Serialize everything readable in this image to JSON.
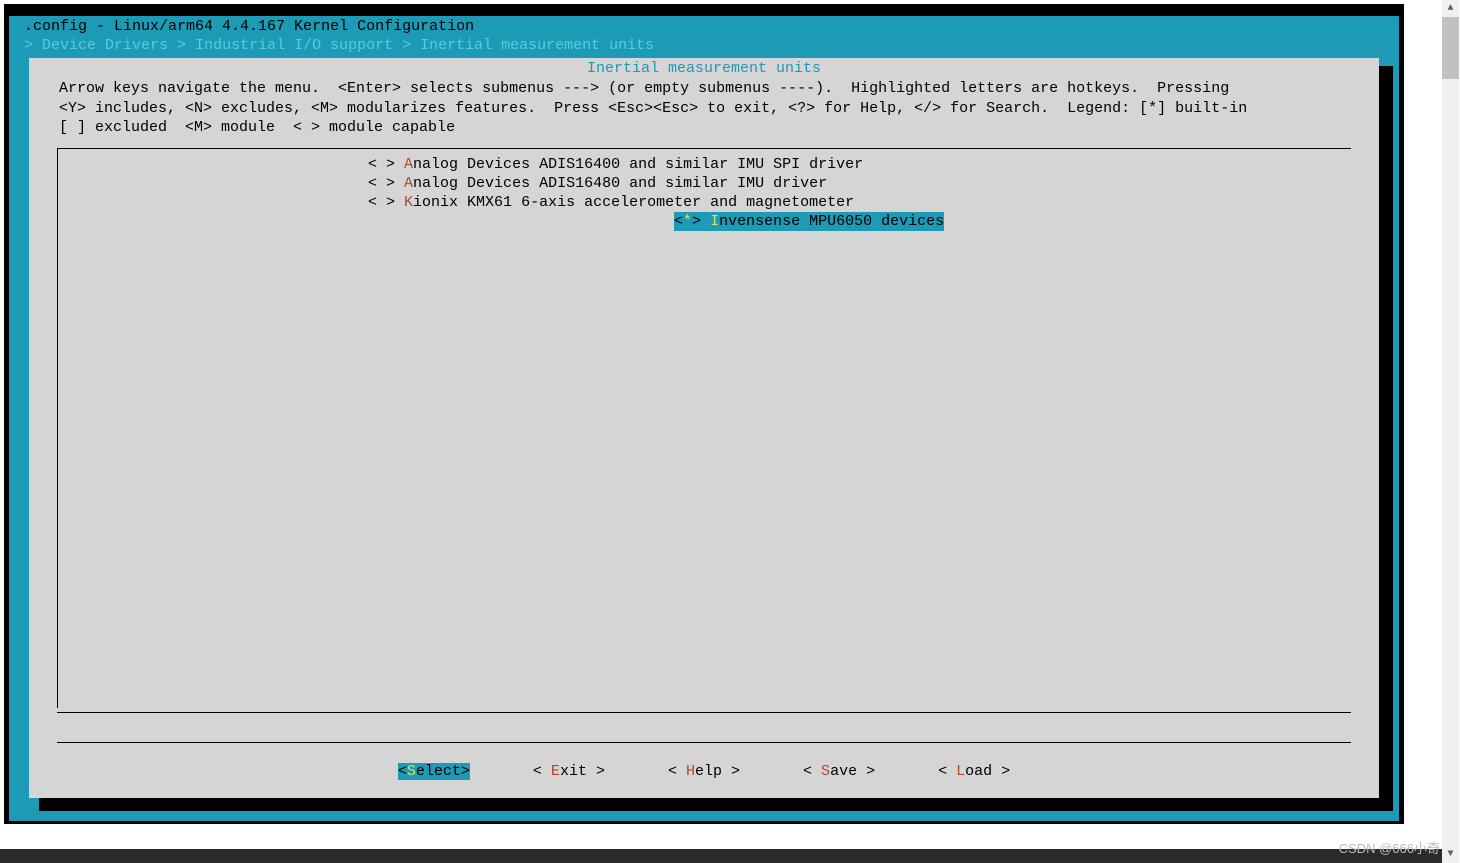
{
  "title_bar": ".config - Linux/arm64 4.4.167 Kernel Configuration",
  "breadcrumb": {
    "arrow": " > ",
    "items": [
      "Device Drivers",
      "Industrial I/O support",
      "Inertial measurement units"
    ],
    "tail_rule": " ───────────────────────────────────────────────────────────────────────────"
  },
  "panel": {
    "title": "Inertial measurement units",
    "help_text": "Arrow keys navigate the menu.  <Enter> selects submenus ---> (or empty submenus ----).  Highlighted letters are hotkeys.  Pressing\n<Y> includes, <N> excludes, <M> modularizes features.  Press <Esc><Esc> to exit, <?> for Help, </> for Search.  Legend: [*] built-in\n[ ] excluded  <M> module  < > module capable"
  },
  "menu_items": [
    {
      "bracket": "< >",
      "hotkey": "A",
      "rest": "nalog Devices ADIS16400 and similar IMU SPI driver",
      "selected": false
    },
    {
      "bracket": "< >",
      "hotkey": "A",
      "rest": "nalog Devices ADIS16480 and similar IMU driver",
      "selected": false
    },
    {
      "bracket": "< >",
      "hotkey": "K",
      "rest": "ionix KMX61 6-axis accelerometer and magnetometer",
      "selected": false
    },
    {
      "bracket_l": "<",
      "star": "*",
      "bracket_r": ">",
      "hotkey": "I",
      "rest": "nvensense MPU6050 devices",
      "selected": true
    }
  ],
  "buttons": [
    {
      "pre": "<",
      "hot": "S",
      "rest": "elect>",
      "selected": true
    },
    {
      "pre": "< ",
      "hot": "E",
      "rest": "xit >",
      "selected": false
    },
    {
      "pre": "< ",
      "hot": "H",
      "rest": "elp >",
      "selected": false
    },
    {
      "pre": "< ",
      "hot": "S",
      "rest": "ave >",
      "selected": false
    },
    {
      "pre": "< ",
      "hot": "L",
      "rest": "oad >",
      "selected": false
    }
  ],
  "watermark": "CSDN @666小奇"
}
